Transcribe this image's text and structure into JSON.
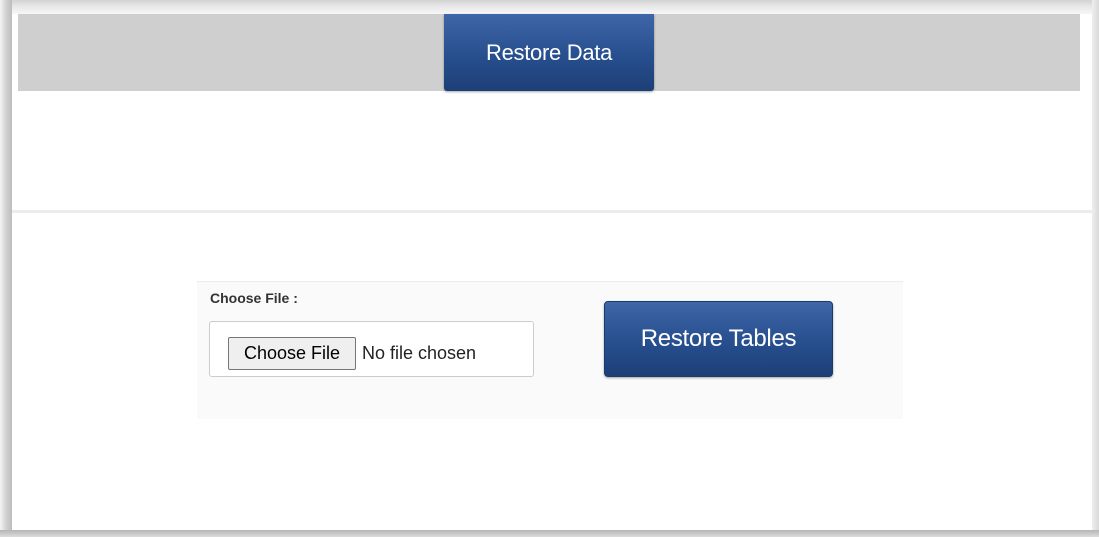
{
  "header": {
    "tab_label": "Restore Data"
  },
  "form": {
    "file_label": "Choose File :",
    "choose_button_label": "Choose File",
    "file_status": "No file chosen",
    "restore_button_label": "Restore Tables"
  },
  "colors": {
    "header_bar": "#cfcfcf",
    "button_primary": "#274f8e",
    "panel_background": "#fafafa"
  }
}
